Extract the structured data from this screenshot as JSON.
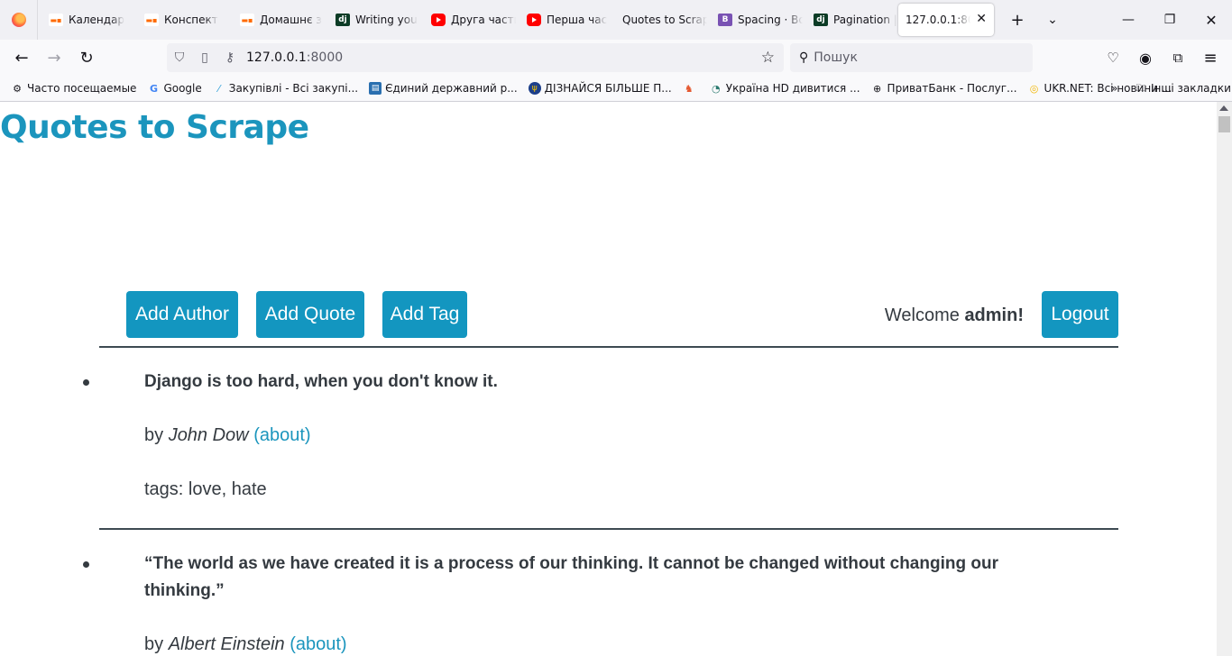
{
  "browser": {
    "tabs": [
      {
        "title": "Календар",
        "favicon": "rd-icon"
      },
      {
        "title": "Конспект",
        "favicon": "rd-icon"
      },
      {
        "title": "Домашнє з",
        "favicon": "rd-icon"
      },
      {
        "title": "Writing you",
        "favicon": "dj"
      },
      {
        "title": "Друга части",
        "favicon": "youtube-icon"
      },
      {
        "title": "Перша час",
        "favicon": "youtube-icon"
      },
      {
        "title": "Quotes to Scrap",
        "favicon": "none"
      },
      {
        "title": "Spacing · Bo",
        "favicon": "B"
      },
      {
        "title": "Pagination |",
        "favicon": "dj"
      },
      {
        "title": "127.0.0.1:8000",
        "favicon": "none"
      }
    ],
    "active_tab_index": 9,
    "url_host": "127.0.0.1",
    "url_port": ":8000",
    "search_placeholder": "Пошук",
    "bookmarks": [
      {
        "label": "Часто посещаемые",
        "icon": "gear-icon"
      },
      {
        "label": "Google",
        "icon": "G"
      },
      {
        "label": "Закупівлі - Всі закупі...",
        "icon": "prozorro-icon"
      },
      {
        "label": "Єдиний державний р...",
        "icon": "registry-icon"
      },
      {
        "label": "ДІЗНАЙСЯ БІЛЬШЕ П...",
        "icon": "emblem-icon"
      },
      {
        "label": "",
        "icon": "cat-icon"
      },
      {
        "label": "Україна HD дивитися ...",
        "icon": "eye-icon"
      },
      {
        "label": "ПриватБанк - Послуг...",
        "icon": "globe-icon"
      },
      {
        "label": "UKR.NET: Всі новини ...",
        "icon": "ukrnet-icon"
      }
    ],
    "other_bookmarks": "Інші закладки"
  },
  "page": {
    "site_title": "Quotes to Scrape",
    "buttons": {
      "add_author": "Add Author",
      "add_quote": "Add Quote",
      "add_tag": "Add Tag",
      "logout": "Logout"
    },
    "welcome_prefix": "Welcome",
    "username": "admin!",
    "quotes": [
      {
        "text": "Django is too hard, when you don't know it.",
        "by_prefix": "by",
        "author": "John Dow",
        "about": "(about)",
        "tags": "tags: love, hate"
      },
      {
        "text": "“The world as we have created it is a process of our thinking. It cannot be changed without changing our thinking.”",
        "by_prefix": "by",
        "author": "Albert Einstein",
        "about": "(about)"
      }
    ]
  },
  "colors": {
    "accent": "#1396c0",
    "title": "#1b95bd",
    "text": "#343a40"
  }
}
